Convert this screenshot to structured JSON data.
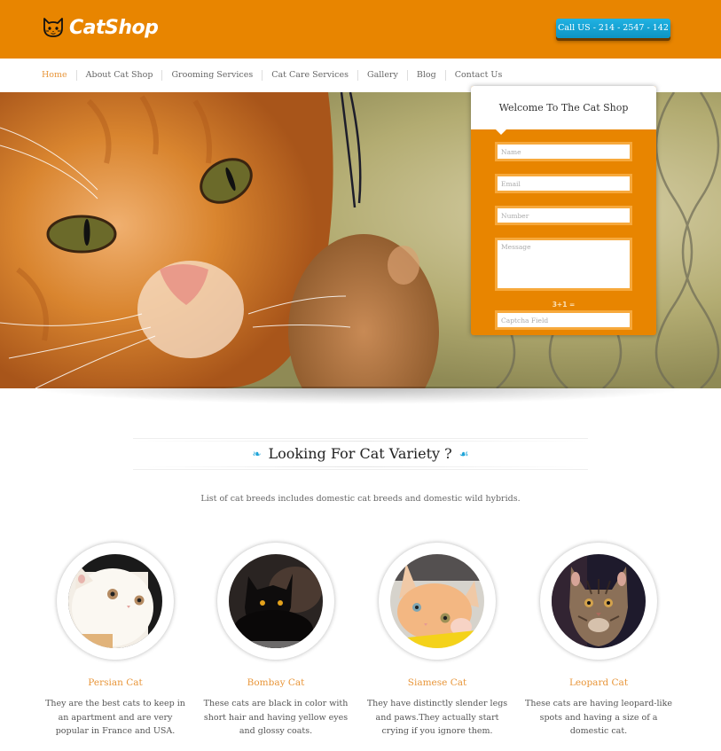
{
  "header": {
    "logo_text": "CatShop",
    "logo_icon": "cat-face-icon",
    "call_button": "Call US - 214 - 2547 - 142"
  },
  "nav": {
    "items": [
      {
        "label": "Home",
        "active": true
      },
      {
        "label": "About Cat Shop",
        "active": false
      },
      {
        "label": "Grooming Services",
        "active": false
      },
      {
        "label": "Cat Care Services",
        "active": false
      },
      {
        "label": "Gallery",
        "active": false
      },
      {
        "label": "Blog",
        "active": false
      },
      {
        "label": "Contact Us",
        "active": false
      }
    ]
  },
  "hero": {
    "image": "orange-tabby-cat-reaching-paw-photo"
  },
  "form": {
    "title": "Welcome To The Cat Shop",
    "fields": {
      "name_placeholder": "Name",
      "email_placeholder": "Email",
      "number_placeholder": "Number",
      "message_placeholder": "Message",
      "captcha_question": "3+1 =",
      "captcha_placeholder": "Captcha Field"
    }
  },
  "section": {
    "title": "Looking For Cat Variety ?",
    "swirl_left": "swirl-ornament-icon",
    "swirl_right": "swirl-ornament-icon",
    "subtitle": "List of cat breeds includes domestic cat breeds and domestic wild hybrids."
  },
  "cats": [
    {
      "name": "Persian Cat",
      "image": "white-persian-cat-photo",
      "description": "They are the best cats to keep in an apartment and are very popular in France and USA."
    },
    {
      "name": "Bombay Cat",
      "image": "black-bombay-cat-photo",
      "description": "These cats are black in color with short hair and having yellow eyes and glossy coats."
    },
    {
      "name": "Siamese Cat",
      "image": "ginger-kitten-photo",
      "description": "They have distinctly slender legs and paws.They actually start crying if you ignore them."
    },
    {
      "name": "Leopard Cat",
      "image": "tabby-leopard-cat-photo",
      "description": "These cats are having leopard-like spots and having a size of a domestic cat."
    }
  ],
  "colors": {
    "brand_orange": "#e88500",
    "accent_orange_text": "#e8963a",
    "call_button_blue": "#1ea4d8",
    "swirl_blue": "#1ea4d8"
  }
}
